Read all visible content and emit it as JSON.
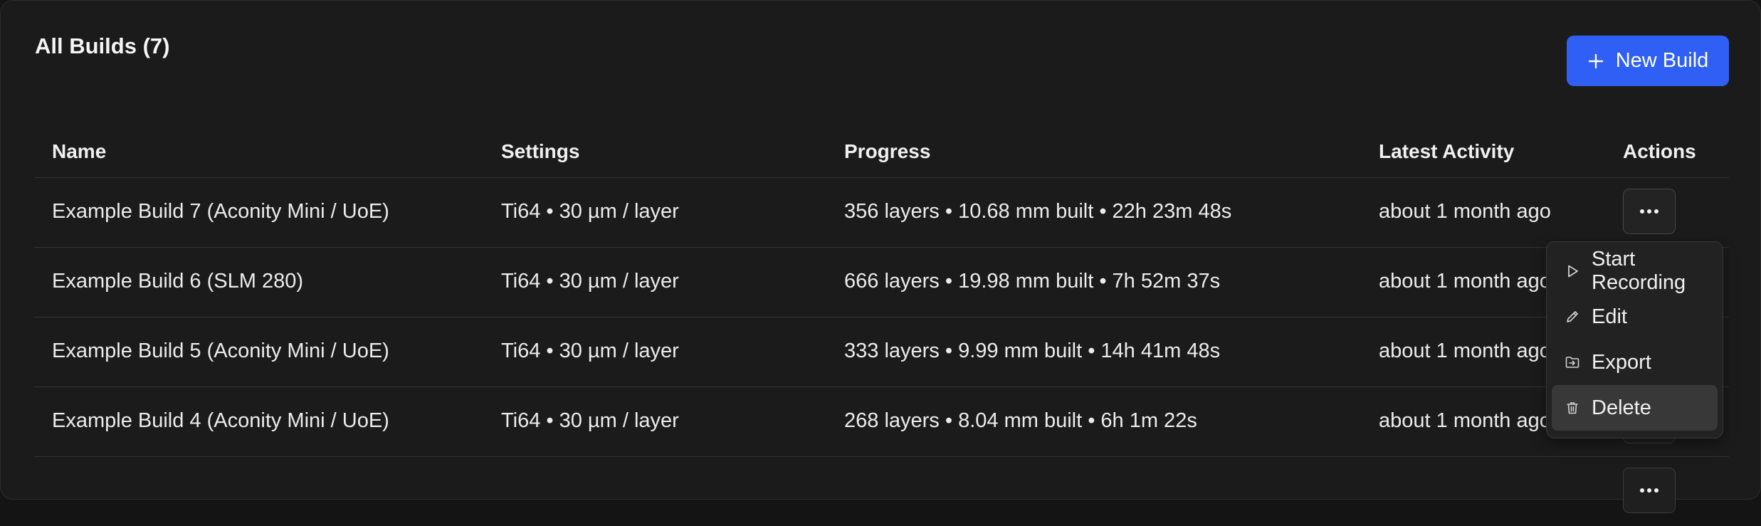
{
  "header": {
    "title": "All Builds (7)",
    "new_build_label": "New Build",
    "accent_color": "#2f5ff5"
  },
  "table": {
    "columns": [
      "Name",
      "Settings",
      "Progress",
      "Latest Activity",
      "Actions"
    ],
    "rows": [
      {
        "name": "Example Build 7 (Aconity Mini / UoE)",
        "settings": "Ti64 • 30 µm / layer",
        "progress": "356 layers • 10.68 mm built • 22h 23m 48s",
        "activity": "about 1 month ago"
      },
      {
        "name": "Example Build 6 (SLM 280)",
        "settings": "Ti64 • 30 µm / layer",
        "progress": "666 layers • 19.98 mm built • 7h 52m 37s",
        "activity": "about 1 month ago"
      },
      {
        "name": "Example Build 5 (Aconity Mini / UoE)",
        "settings": "Ti64 • 30 µm / layer",
        "progress": "333 layers • 9.99 mm built • 14h 41m 48s",
        "activity": "about 1 month ago"
      },
      {
        "name": "Example Build 4 (Aconity Mini / UoE)",
        "settings": "Ti64 • 30 µm / layer",
        "progress": "268 layers • 8.04 mm built • 6h 1m 22s",
        "activity": "about 1 month ago"
      }
    ],
    "actions_icon": "more-horizontal-icon"
  },
  "actions_menu": {
    "items": [
      {
        "label": "Start Recording",
        "icon": "play-icon"
      },
      {
        "label": "Edit",
        "icon": "pencil-icon"
      },
      {
        "label": "Export",
        "icon": "folder-export-icon"
      },
      {
        "label": "Delete",
        "icon": "trash-icon"
      }
    ],
    "highlighted_index": 3
  }
}
